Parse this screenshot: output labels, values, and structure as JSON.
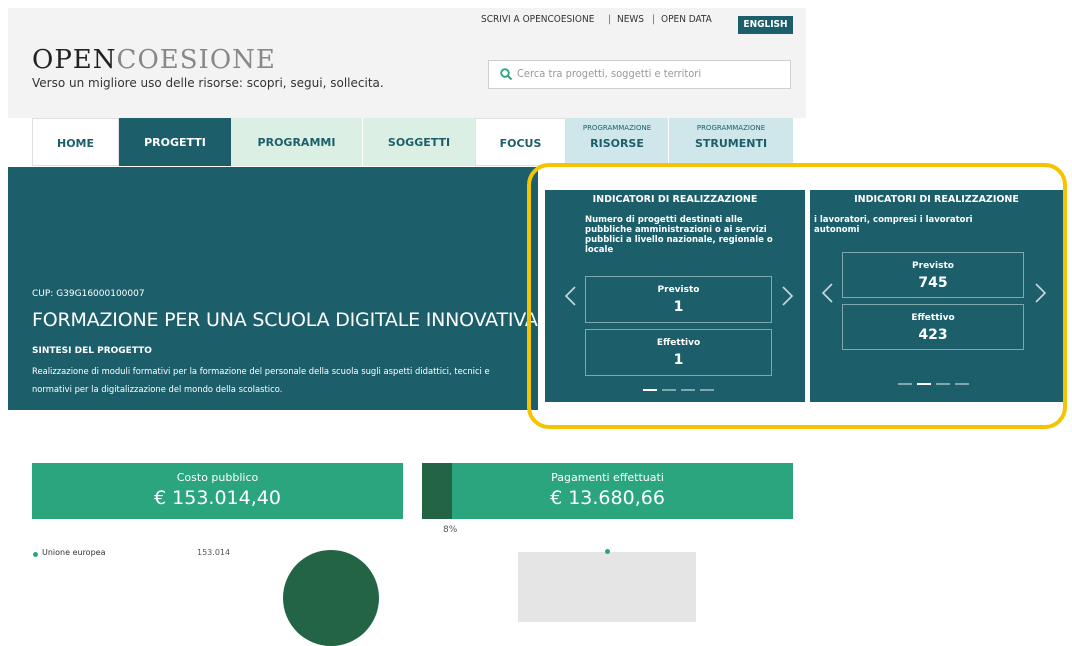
{
  "header": {
    "links": [
      "SCRIVI A OPENCOESIONE",
      "NEWS",
      "OPEN DATA"
    ],
    "language_button": "ENGLISH",
    "logo_bold": "OPEN",
    "logo_light": "COESIONE",
    "tagline": "Verso un migliore uso delle risorse: scopri, segui, sollecita.",
    "search_placeholder": "Cerca tra progetti, soggetti e territori"
  },
  "nav": {
    "tabs": [
      {
        "label": "HOME"
      },
      {
        "label": "PROGETTI",
        "active": true
      },
      {
        "label": "PROGRAMMI"
      },
      {
        "label": "SOGGETTI"
      },
      {
        "label": "FOCUS"
      },
      {
        "label": "RISORSE",
        "small": "PROGRAMMAZIONE"
      },
      {
        "label": "STRUMENTI",
        "small": "PROGRAMMAZIONE"
      }
    ]
  },
  "project": {
    "cup": "CUP: G39G16000100007",
    "title": "FORMAZIONE PER UNA SCUOLA DIGITALE INNOVATIVA",
    "summary_heading": "SINTESI DEL PROGETTO",
    "summary": "Realizzazione di moduli formativi per la formazione del personale della scuola sugli aspetti didattici, tecnici e normativi per la digitalizzazione del mondo della scolastico."
  },
  "indicators": [
    {
      "heading": "INDICATORI DI REALIZZAZIONE",
      "description": "Numero di progetti destinati alle pubbliche amministrazioni o ai servizi pubblici a livello nazionale, regionale o locale",
      "planned_label": "Previsto",
      "planned_value": "1",
      "actual_label": "Effettivo",
      "actual_value": "1",
      "active_dot": 1
    },
    {
      "heading": "INDICATORI DI REALIZZAZIONE",
      "description": "i lavoratori, compresi i lavoratori autonomi",
      "planned_label": "Previsto",
      "planned_value": "745",
      "actual_label": "Effettivo",
      "actual_value": "423",
      "active_dot": 2
    }
  ],
  "stats": {
    "cost_label": "Costo pubblico",
    "cost_value": "€ 153.014,40",
    "payments_label": "Pagamenti effettuati",
    "payments_value": "€ 13.680,66",
    "payments_percent_label": "8%",
    "payments_fraction": 0.08
  },
  "funding": {
    "legend_label": "Unione europea",
    "legend_value": "153.014"
  },
  "colors": {
    "teal": "#1c5f6b",
    "green": "#2aa57e",
    "dark_green": "#226444",
    "highlight": "#f5c400",
    "nav_green": "#dcefe4",
    "nav_blue": "#cfe6ea"
  }
}
